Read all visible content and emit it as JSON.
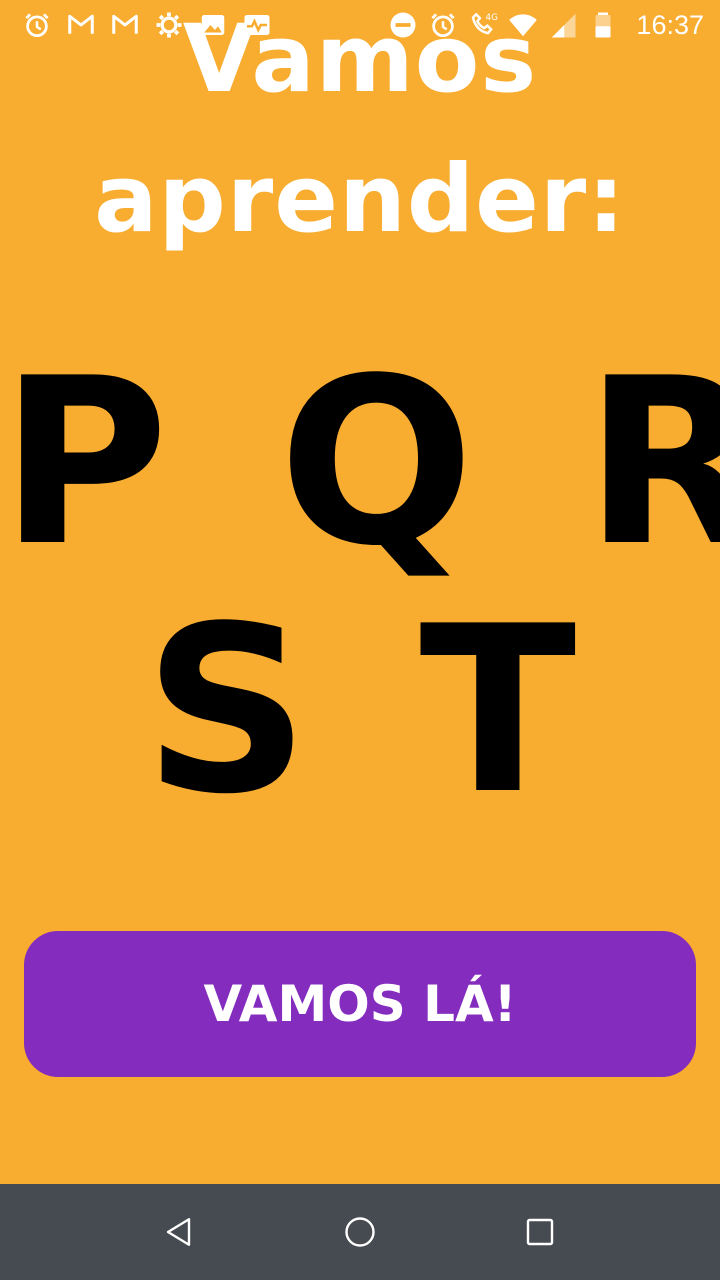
{
  "status_bar": {
    "time": "16:37",
    "network": "4G",
    "left_icons": [
      "alarm-icon",
      "gmail-icon",
      "gmail-icon",
      "settings-icon",
      "gallery-icon",
      "activity-icon"
    ],
    "right_icons": [
      "do-not-disturb-icon",
      "alarm-icon",
      "wifi-call-icon",
      "wifi-icon",
      "signal-icon",
      "battery-icon"
    ]
  },
  "title": {
    "line1": "Vamos",
    "line2": "aprender:"
  },
  "letters": {
    "row1": "P Q R",
    "row2": "S T"
  },
  "cta": {
    "label": "VAMOS LÁ!"
  },
  "nav_bar": {
    "buttons": [
      "back-icon",
      "home-icon",
      "recents-icon"
    ]
  },
  "colors": {
    "background": "#F8AC30",
    "button": "#842CBE",
    "nav_bar": "#454B50",
    "title_text": "#FFFFFF",
    "letters_text": "#000000"
  }
}
